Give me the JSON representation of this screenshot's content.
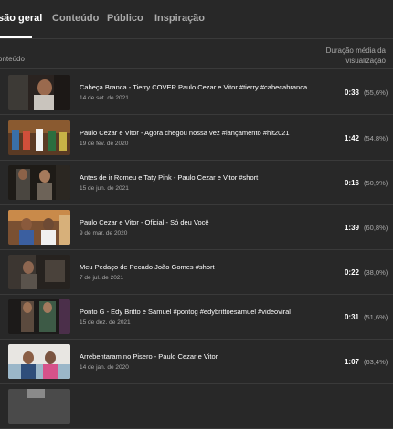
{
  "tabs": [
    {
      "label": "são geral",
      "active": true
    },
    {
      "label": "Conteúdo",
      "active": false
    },
    {
      "label": "Público",
      "active": false
    },
    {
      "label": "Inspiração",
      "active": false
    }
  ],
  "table": {
    "col_content": "onteúdo",
    "col_duration_line1": "Duração média da",
    "col_duration_line2": "visualização",
    "rows": [
      {
        "title": "Cabeça Branca - Tierry COVER Paulo Cezar e Vitor #tierry #cabecabranca",
        "date": "14 de set. de 2021",
        "duration": "0:33",
        "percent": "(55,6%)"
      },
      {
        "title": "Paulo Cezar e Vitor - Agora chegou nossa vez #lançamento #hit2021",
        "date": "19 de fev. de 2020",
        "duration": "1:42",
        "percent": "(54,8%)"
      },
      {
        "title": "Antes de ir Romeu e Taty Pink - Paulo Cezar e Vitor #short",
        "date": "15 de jun. de 2021",
        "duration": "0:16",
        "percent": "(50,9%)"
      },
      {
        "title": "Paulo Cezar e Vitor - Oficial - Só deu Você",
        "date": "9 de mar. de 2020",
        "duration": "1:39",
        "percent": "(60,8%)"
      },
      {
        "title": "Meu Pedaço de Pecado João Gomes #short",
        "date": "7 de jul. de 2021",
        "duration": "0:22",
        "percent": "(38,0%)"
      },
      {
        "title": "Ponto G - Edy Britto e Samuel #pontog #edybrittoesamuel #videoviral",
        "date": "15 de dez. de 2021",
        "duration": "0:31",
        "percent": "(51,6%)"
      },
      {
        "title": "Arrebentaram no Pisero - Paulo Cezar e Vitor",
        "date": "14 de jan. de 2020",
        "duration": "1:07",
        "percent": "(63,4%)"
      },
      {
        "title": "",
        "date": "",
        "duration": "",
        "percent": ""
      }
    ]
  }
}
